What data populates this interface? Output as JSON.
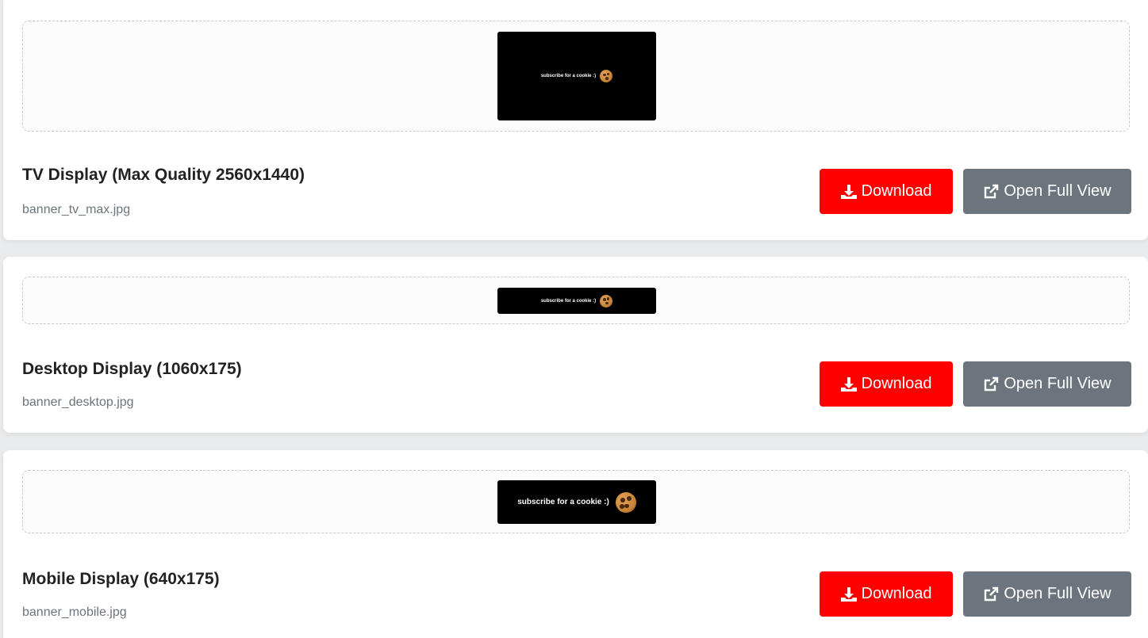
{
  "cards": [
    {
      "title": "TV Display (Max Quality 2560x1440)",
      "filename": "banner_tv_max.jpg",
      "banner_text": "subscribe for a cookie :)",
      "download_label": "Download",
      "open_label": "Open Full View"
    },
    {
      "title": "Desktop Display (1060x175)",
      "filename": "banner_desktop.jpg",
      "banner_text": "subscribe for a cookie :)",
      "download_label": "Download",
      "open_label": "Open Full View"
    },
    {
      "title": "Mobile Display (640x175)",
      "filename": "banner_mobile.jpg",
      "banner_text": "subscribe for a cookie :)",
      "download_label": "Download",
      "open_label": "Open Full View"
    }
  ],
  "icons": {
    "download": "download-icon",
    "open": "external-link-icon",
    "cookie": "cookie-icon"
  },
  "colors": {
    "download_button": "#ff0000",
    "open_button": "#6c757d",
    "banner_background": "#000000",
    "filename_text": "#6c757d"
  }
}
